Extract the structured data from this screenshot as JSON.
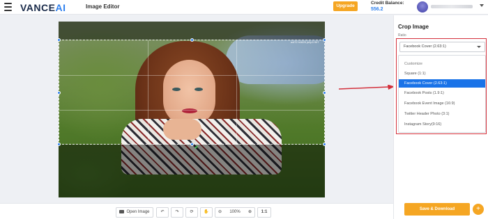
{
  "header": {
    "logo_main": "VANCE",
    "logo_accent": "AI",
    "app_title": "Image Editor",
    "upgrade_label": "Upgrade",
    "credit_label": "Credit Balance:",
    "credit_value": "556.2"
  },
  "canvas": {
    "dimension_label": "w472 h1625 jn2p3 907"
  },
  "toolbar": {
    "open_image_label": "Open Image",
    "zoom_value": "100%",
    "ratio_label": "1:1"
  },
  "panel": {
    "title": "Crop Image",
    "ratio_label": "Ratio",
    "selected_ratio": "Facebook Cover (2.63:1)",
    "options": [
      "Customize",
      "Square (1:1)",
      "Facebook Cover (2.63:1)",
      "Facebook Posts (1.9:1)",
      "Facebook Event Image (16:9)",
      "Twitter Header Photo (3:1)",
      "Instagram Story(9:16)"
    ],
    "selected_index": 2,
    "save_label": "Save & Download",
    "plus_label": "+"
  },
  "colors": {
    "accent": "#f5a623",
    "brand_blue": "#2f80ed",
    "selected_bg": "#1a73e8",
    "highlight_red": "#d32f3a"
  },
  "icons": [
    "hamburger-icon",
    "folder-icon",
    "undo-icon",
    "redo-icon",
    "rotate-icon",
    "hand-icon",
    "zoom-out-icon",
    "zoom-in-icon",
    "chevron-down-icon",
    "plus-icon"
  ]
}
